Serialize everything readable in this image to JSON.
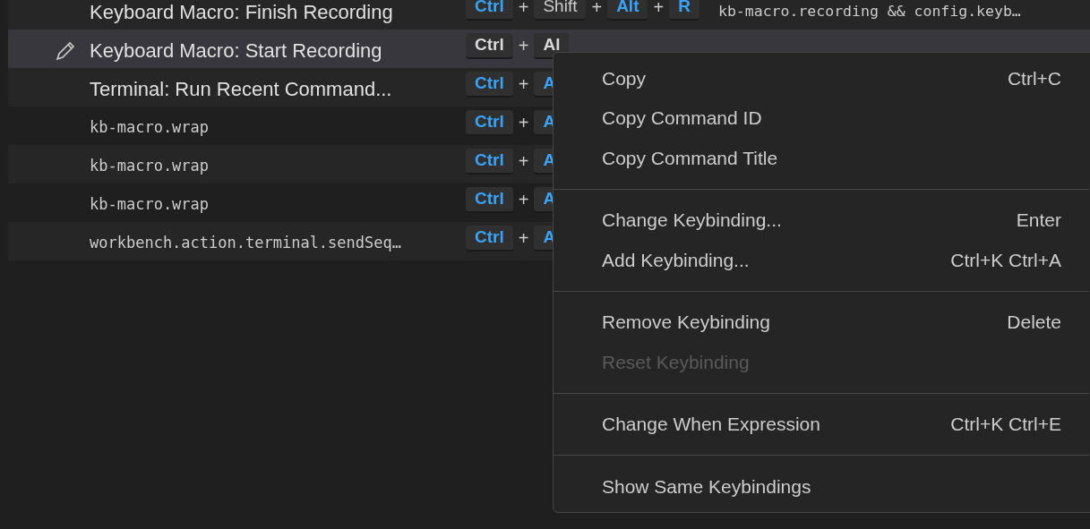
{
  "rows": [
    {
      "command": "Keyboard Macro: Finish Recording",
      "mono": false,
      "selected": false,
      "keys": [
        {
          "label": "Ctrl",
          "highlighted": true
        },
        {
          "prefix": "+",
          "label": "Shift",
          "highlighted": false
        },
        {
          "prefix": "+",
          "label": "Alt",
          "highlighted": true
        },
        {
          "prefix": "+",
          "label": "R",
          "highlighted": true
        }
      ],
      "when": "kb-macro.recording && config.keyb…"
    },
    {
      "command": "Keyboard Macro: Start Recording",
      "mono": false,
      "selected": true,
      "keys": [
        {
          "label": "Ctrl",
          "highlighted": false
        },
        {
          "prefix": "+",
          "label": "Al",
          "highlighted": false
        }
      ]
    },
    {
      "command": "Terminal: Run Recent Command...",
      "mono": false,
      "selected": false,
      "keys": [
        {
          "label": "Ctrl",
          "highlighted": true
        },
        {
          "prefix": "+",
          "label": "A",
          "highlighted": true
        }
      ]
    },
    {
      "command": "kb-macro.wrap",
      "mono": true,
      "selected": false,
      "keys": [
        {
          "label": "Ctrl",
          "highlighted": true
        },
        {
          "prefix": "+",
          "label": "A",
          "highlighted": true
        }
      ]
    },
    {
      "command": "kb-macro.wrap",
      "mono": true,
      "selected": false,
      "keys": [
        {
          "label": "Ctrl",
          "highlighted": true
        },
        {
          "prefix": "+",
          "label": "A",
          "highlighted": true
        }
      ]
    },
    {
      "command": "kb-macro.wrap",
      "mono": true,
      "selected": false,
      "keys": [
        {
          "label": "Ctrl",
          "highlighted": true
        },
        {
          "prefix": "+",
          "label": "A",
          "highlighted": true
        }
      ]
    },
    {
      "command": "workbench.action.terminal.sendSeq…",
      "mono": true,
      "selected": false,
      "keys": [
        {
          "label": "Ctrl",
          "highlighted": true
        },
        {
          "prefix": "+",
          "label": "A",
          "highlighted": true
        }
      ]
    }
  ],
  "context_menu": {
    "groups": [
      [
        {
          "label": "Copy",
          "shortcut": "Ctrl+C",
          "disabled": false
        },
        {
          "label": "Copy Command ID",
          "disabled": false
        },
        {
          "label": "Copy Command Title",
          "disabled": false
        }
      ],
      [
        {
          "label": "Change Keybinding...",
          "shortcut": "Enter",
          "disabled": false
        },
        {
          "label": "Add Keybinding...",
          "shortcut": "Ctrl+K Ctrl+A",
          "disabled": false
        }
      ],
      [
        {
          "label": "Remove Keybinding",
          "shortcut": "Delete",
          "disabled": false
        },
        {
          "label": "Reset Keybinding",
          "disabled": true
        }
      ],
      [
        {
          "label": "Change When Expression",
          "shortcut": "Ctrl+K Ctrl+E",
          "disabled": false
        }
      ],
      [
        {
          "label": "Show Same Keybindings",
          "disabled": false
        }
      ]
    ]
  }
}
